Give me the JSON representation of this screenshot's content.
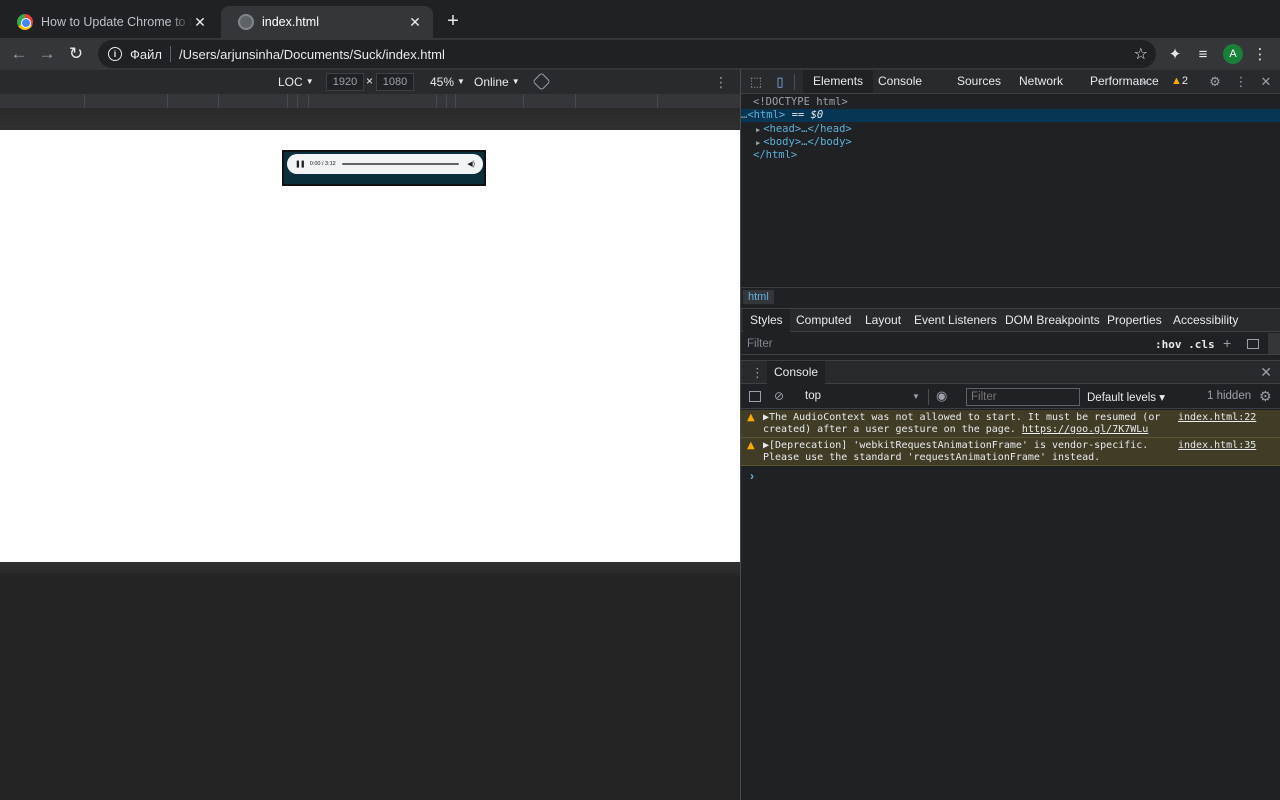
{
  "tabs": [
    {
      "title": "How to Update Chrome to the Latest Version",
      "close": "✕"
    },
    {
      "title": "index.html",
      "close": "✕"
    }
  ],
  "new_tab_label": "+",
  "toolbar": {
    "back": "←",
    "forward": "→",
    "reload": "↻",
    "protocol_label": "Файл",
    "url": "/Users/arjunsinha/Documents/Suck/index.html",
    "avatar_letter": "A"
  },
  "device_toolbar": {
    "device": "LOC",
    "width": "1920",
    "times": "×",
    "height": "1080",
    "zoom": "45%",
    "throttling": "Online"
  },
  "audio_player": {
    "time": "0:00 / 3:12",
    "progress_fraction": 0
  },
  "devtools": {
    "tabs": [
      "Elements",
      "Console",
      "Sources",
      "Network",
      "Performance"
    ],
    "overflow": "»",
    "warning_count": "2",
    "dom_lines": {
      "doctype": "<!DOCTYPE html>",
      "html_open": "<html>",
      "selected_suffix": " == ",
      "selected_var": "$0",
      "head": "<head>…</head>",
      "body": "<body>…</body>",
      "html_close": "</html>"
    },
    "breadcrumb": "html",
    "styles_tabs": [
      "Styles",
      "Computed",
      "Layout",
      "Event Listeners",
      "DOM Breakpoints",
      "Properties",
      "Accessibility"
    ],
    "styles_filter_placeholder": "Filter",
    "hov_cls": ":hov .cls",
    "drawer_tab": "Console",
    "console": {
      "context": "top",
      "filter_placeholder": "Filter",
      "levels": "Default levels ▾",
      "hidden": "1 hidden",
      "messages": [
        {
          "text_line1": "▶The AudioContext was not allowed to start. It must be resumed (or",
          "text_line2_prefix": "created) after a user gesture on the page. ",
          "link": "https://goo.gl/7K7WLu",
          "source": "index.html:22"
        },
        {
          "text_line1": "▶[Deprecation] 'webkitRequestAnimationFrame' is vendor-specific.",
          "text_line2_prefix": "Please use the standard 'requestAnimationFrame' instead.",
          "link": "",
          "source": "index.html:35"
        }
      ],
      "prompt": "›"
    }
  },
  "colors": {
    "selected_row": "#073655",
    "warning_bg": "#413c26",
    "tag_blue": "#5db0d7",
    "warning_icon": "#f9ab00"
  },
  "icons": {
    "favicon_tab1": "chrome-logo-icon",
    "favicon_tab2": "globe-icon",
    "info": "info-icon",
    "star": "star-icon",
    "extensions": "puzzle-icon",
    "media": "media-queue-icon",
    "menu": "kebab-icon"
  }
}
